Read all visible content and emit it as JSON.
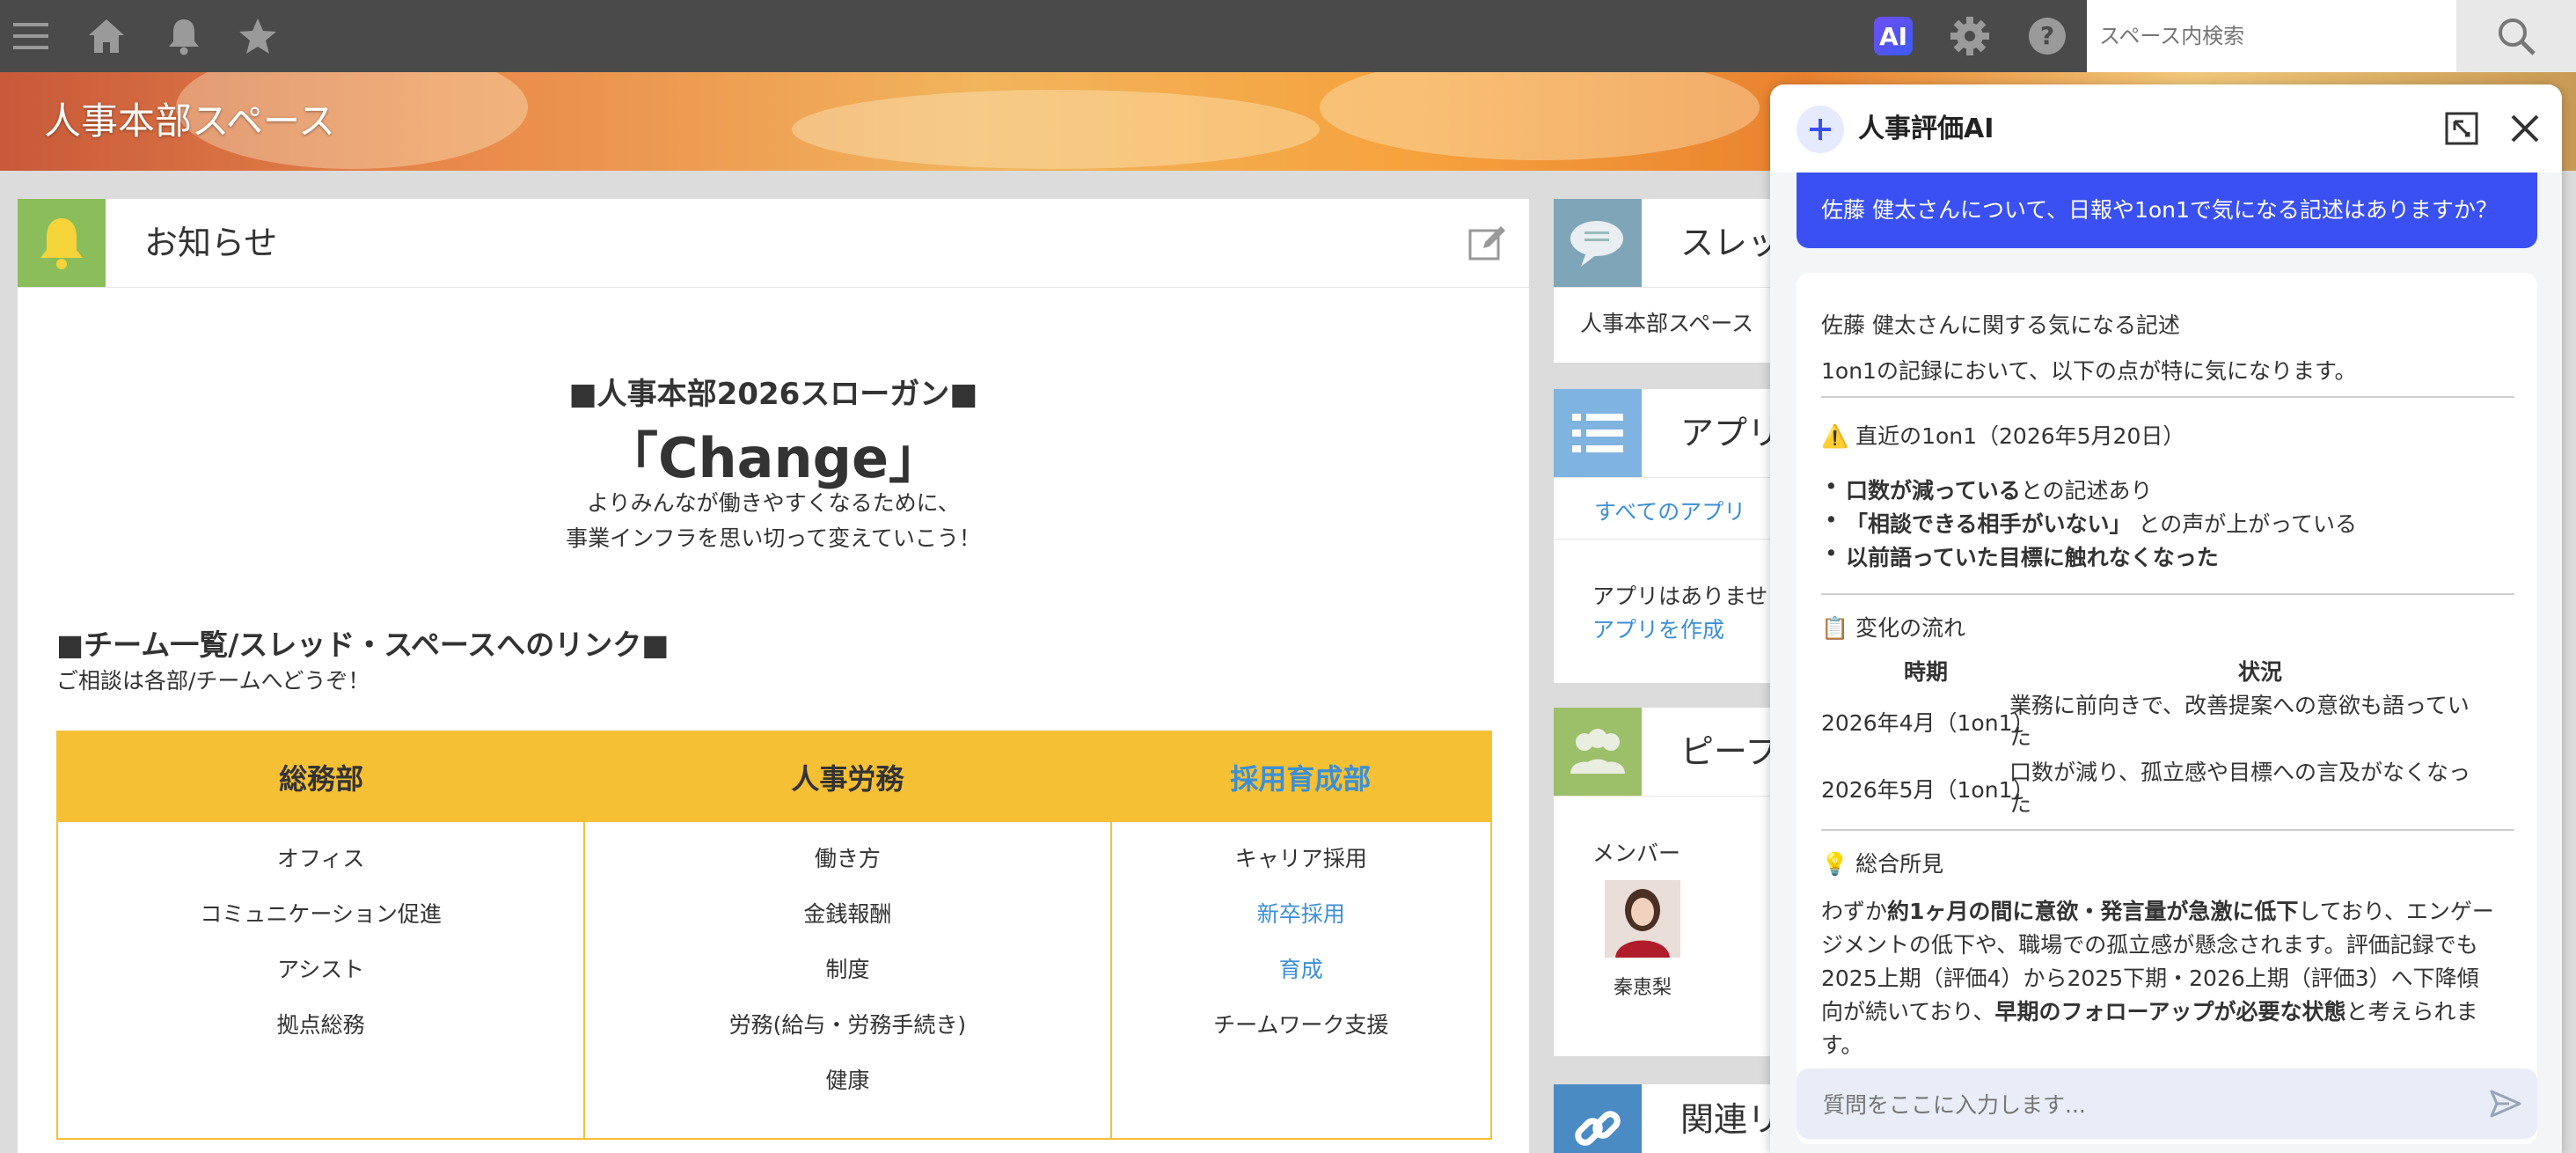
{
  "search": {
    "placeholder": "スペース内検索"
  },
  "topbar": {
    "ai_badge": "AI"
  },
  "space": {
    "title": "人事本部スペース"
  },
  "notice": {
    "title": "お知らせ",
    "slogan_heading": "■人事本部2026スローガン■",
    "slogan_main": "「Change」",
    "slogan_line1": "よりみんなが働きやすくなるために、",
    "slogan_line2": "事業インフラを思い切って変えていこう！",
    "teams_heading": "■チーム一覧/スレッド・スペースへのリンク■",
    "teams_sub": "ご相談は各部/チームへどうぞ！",
    "columns": [
      {
        "header": "総務部",
        "items": [
          "オフィス",
          "コミュニケーション促進",
          "アシスト",
          "拠点総務"
        ]
      },
      {
        "header": "人事労務",
        "items": [
          "働き方",
          "金銭報酬",
          "制度",
          "労務(給与・労務手続き)",
          "健康"
        ]
      },
      {
        "header": "採用育成部",
        "items": [
          "キャリア採用",
          "新卒採用",
          "育成",
          "チームワーク支援"
        ]
      }
    ]
  },
  "threads": {
    "title": "スレッ",
    "item": "人事本部スペース"
  },
  "apps": {
    "title": "アプリ",
    "tab": "すべてのアプリ",
    "empty": "アプリはありませ",
    "create": "アプリを作成"
  },
  "people": {
    "title": "ピープ",
    "members_label": "メンバー",
    "member_name": "秦恵梨"
  },
  "links": {
    "title": "関連リ"
  },
  "ai": {
    "title": "人事評価AI",
    "user_question": "佐藤 健太さんについて、日報や1on1で気になる記述はありますか？",
    "answer_title": "佐藤 健太さんに関する気になる記述",
    "answer_intro": "1on1の記録において、以下の点が特に気になります。",
    "recent_heading": "⚠️ 直近の1on1（2026年5月20日）",
    "bullets": [
      {
        "bold": "口数が減っている",
        "rest": "との記述あり"
      },
      {
        "bold": "「相談できる相手がいない」",
        "rest": " との声が上がっている"
      },
      {
        "bold": "以前語っていた目標に触れなくなった",
        "rest": ""
      }
    ],
    "flow_heading": "📋 変化の流れ",
    "table_headers": [
      "時期",
      "状況"
    ],
    "table_rows": [
      {
        "period": "2026年4月（1on1）",
        "status_line1": "業務に前向きで、改善提案への意欲も語ってい",
        "status_line2": "た"
      },
      {
        "period": "2026年5月（1on1）",
        "status_line1": "口数が減り、孤立感や目標への言及がなくなっ",
        "status_line2": "た"
      }
    ],
    "summary_heading": "💡 総合所見",
    "summary_p1_a": "わずか",
    "summary_p1_b": "約1ヶ月の間に意欲・発言量が急激に低下",
    "summary_p1_c": "しており、エンゲー",
    "summary_p2": "ジメントの低下や、職場での孤立感が懸念されます。評価記録でも",
    "summary_p3": "2025上期（評価4）から2025下期・2026上期（評価3）へ下降傾",
    "summary_p4_a": "向が続いており、",
    "summary_p4_b": "早期のフォローアップが必要な状態",
    "summary_p4_c": "と考えられま",
    "summary_p5": "す。",
    "input_placeholder": "質問をここに入力します..."
  },
  "colors": {
    "topbar": "#4a4a4a",
    "accent_blue": "#3a50f3",
    "team_header": "#f5c033",
    "link": "#3b8fd6"
  }
}
